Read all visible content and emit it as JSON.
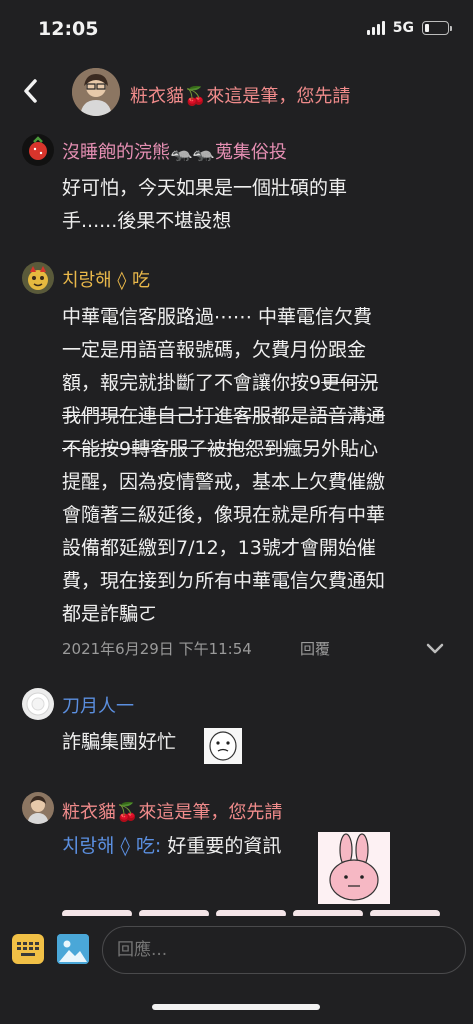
{
  "status": {
    "time": "12:05",
    "network": "5G"
  },
  "header": {
    "name": "粧衣貓🍒來這是筆，您先請"
  },
  "comments": [
    {
      "name": "沒睡飽的浣熊🦡🦡蒐集俗投",
      "lines": [
        "好可怕，今天如果是一個壯碩的車",
        "手......後果不堪設想"
      ]
    },
    {
      "name": "치랑해 ◊ 吃",
      "lines": [
        "中華電信客服路過⋯⋯ 中華電信欠費",
        "一定是用語音報號碼，欠費月份跟金",
        "額，報完就掛斷了不會讓你按9"
      ],
      "strike_1": "更何況",
      "strike_2": "我們現在連自己打進客服都是語音溝通",
      "strike_3": "不能按9轉客服子被抱怨到瘋",
      "line_after_strike": "另外貼心",
      "lines_rest": [
        "提醒，因為疫情警戒，基本上欠費催繳",
        "會隨著三級延後，像現在就是所有中華",
        "設備都延繳到7/12，13號才會開始催",
        "費，現在接到ㄉ所有中華電信欠費通知",
        "都是詐騙ㄛ"
      ],
      "date": "2021年6月29日 下午11:54",
      "reply": "回覆"
    },
    {
      "name": "刀月人一",
      "text": "詐騙集團好忙"
    },
    {
      "name": "粧衣貓🍒來這是筆，您先請",
      "mention": "치랑해 ◊ 吃:",
      "text": "好重要的資訊"
    }
  ],
  "input": {
    "placeholder": "回應..."
  },
  "icons": {
    "back": "chevron-left-icon",
    "keyboard": "keyboard-icon",
    "image": "image-icon",
    "expand": "chevron-down-icon"
  },
  "colors": {
    "background": "#202022",
    "name_red": "#f08b8b",
    "name_pink": "#e48eb2",
    "name_gold": "#e9b84a",
    "name_blue": "#5b8fe0",
    "mention_blue": "#5b8fe0"
  }
}
